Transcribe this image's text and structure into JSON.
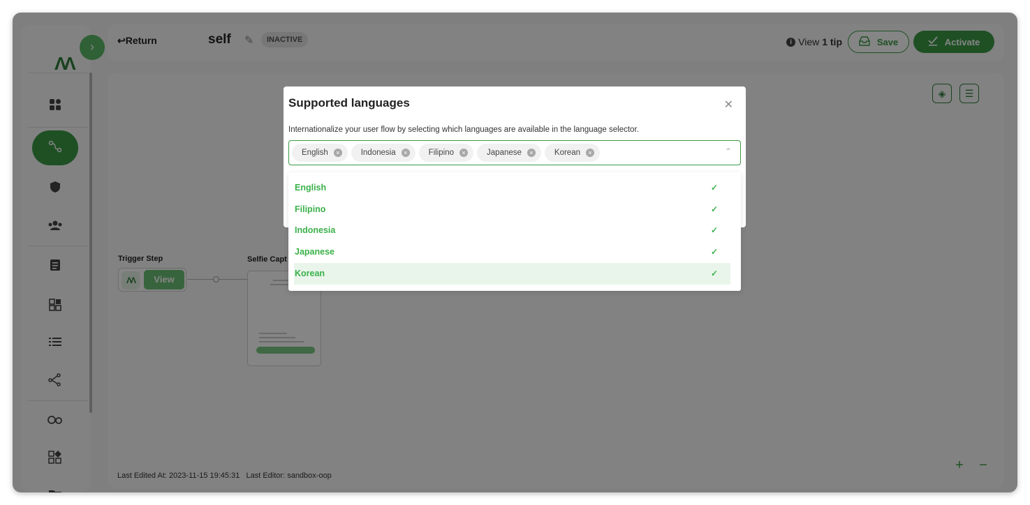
{
  "topbar": {
    "return_label": "Return",
    "flow_title": "self",
    "status": "INACTIVE",
    "tip_prefix": "View",
    "tip_count": "1 tip",
    "save_label": "Save",
    "activate_label": "Activate"
  },
  "canvas": {
    "trigger_step_label": "Trigger Step",
    "view_label": "View",
    "selfie_label": "Selfie Capt",
    "footer_last_edited": "Last Edited At: 2023-11-15 19:45:31",
    "footer_last_editor": "Last Editor: sandbox-oop"
  },
  "modal": {
    "title": "Supported languages",
    "description": "Internationalize your user flow by selecting which languages are available in the language selector.",
    "selected_tags": [
      "English",
      "Indonesia",
      "Filipino",
      "Japanese",
      "Korean"
    ],
    "options": [
      {
        "label": "English",
        "checked": true
      },
      {
        "label": "Filipino",
        "checked": true
      },
      {
        "label": "Indonesia",
        "checked": true
      },
      {
        "label": "Japanese",
        "checked": true
      },
      {
        "label": "Korean",
        "checked": true
      }
    ],
    "highlighted_option": "Korean"
  },
  "colors": {
    "brand_green": "#3a9a46",
    "option_green": "#3ab14a",
    "overlay": "rgba(0,0,0,0.48)"
  },
  "icons": [
    "logo",
    "chevron-right-icon",
    "dashboard-icon",
    "flow-icon",
    "shield-icon",
    "users-icon",
    "document-icon",
    "apps-icon",
    "list-icon",
    "share-icon",
    "loop-icon",
    "widgets-icon",
    "folder-icon",
    "info-icon",
    "inbox-icon",
    "check-icon",
    "edit-icon",
    "paint-bucket-icon",
    "sliders-icon",
    "close-icon",
    "chevron-up-icon",
    "plus-icon",
    "minus-icon"
  ]
}
